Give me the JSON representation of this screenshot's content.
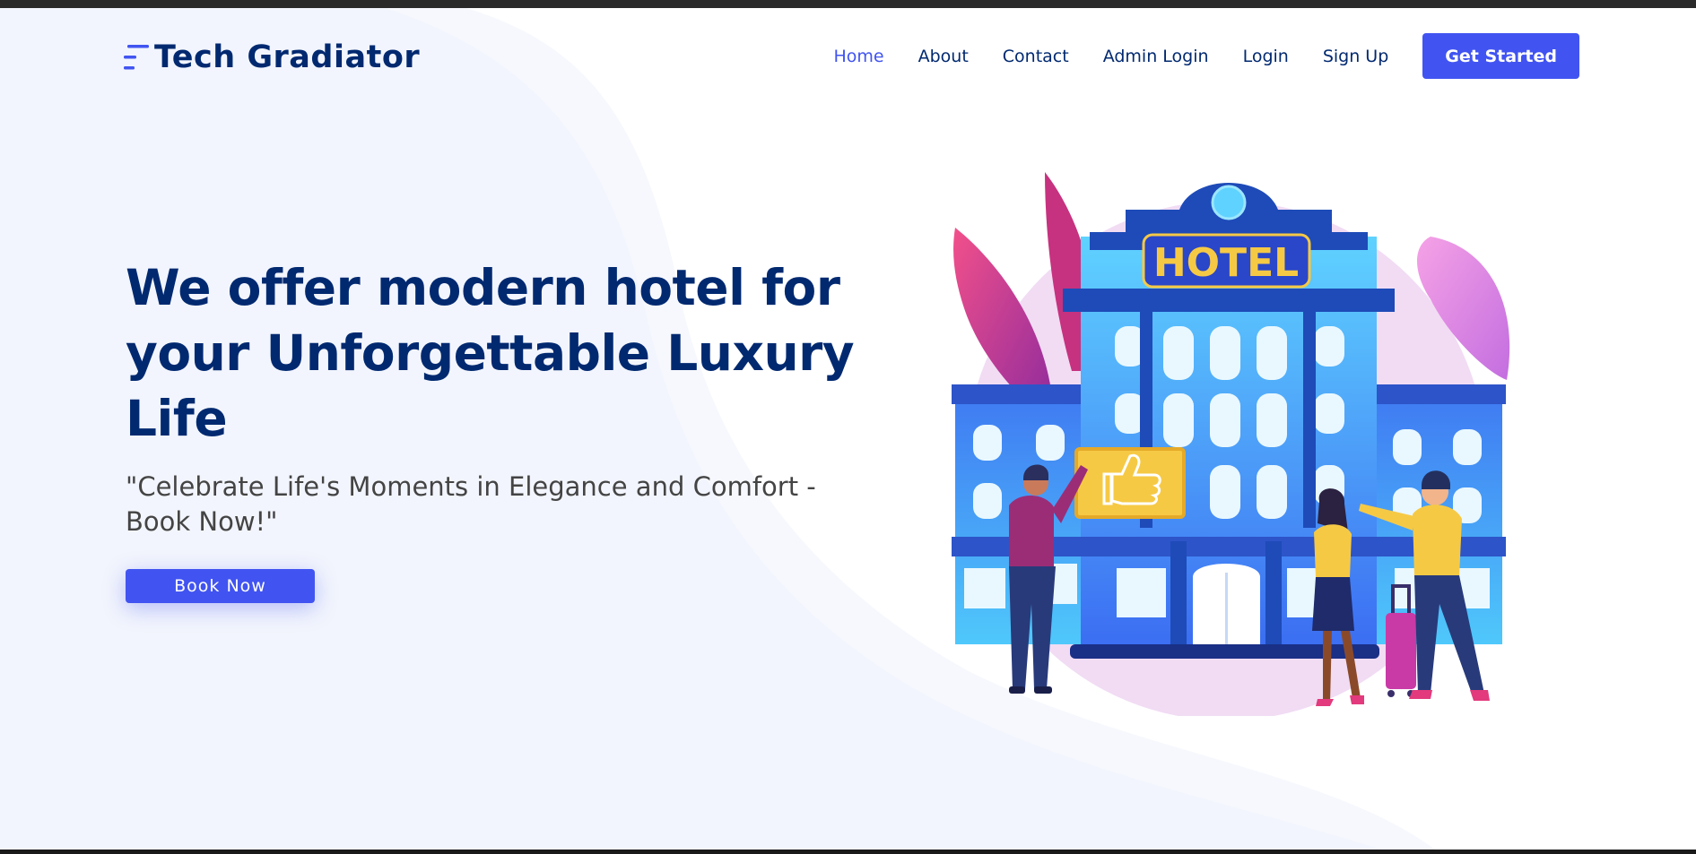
{
  "brand": {
    "name": "Tech Gradiator",
    "icon": "bars-logo-icon"
  },
  "nav": {
    "items": [
      {
        "label": "Home",
        "active": true
      },
      {
        "label": "About",
        "active": false
      },
      {
        "label": "Contact",
        "active": false
      },
      {
        "label": "Admin Login",
        "active": false
      },
      {
        "label": "Login",
        "active": false
      },
      {
        "label": "Sign Up",
        "active": false
      }
    ],
    "cta": "Get Started"
  },
  "hero": {
    "title": "We offer modern hotel for your Unforgettable Luxury Life",
    "subtitle": "\"Celebrate Life's Moments in Elegance and Comfort - Book Now!\"",
    "button": "Book Now",
    "illustration": {
      "sign": "HOTEL",
      "icon": "hotel-illustration"
    }
  },
  "colors": {
    "accent": "#4154f1",
    "heading": "#012970",
    "body_text": "#444444",
    "hero_background": "#f2f5fd"
  }
}
